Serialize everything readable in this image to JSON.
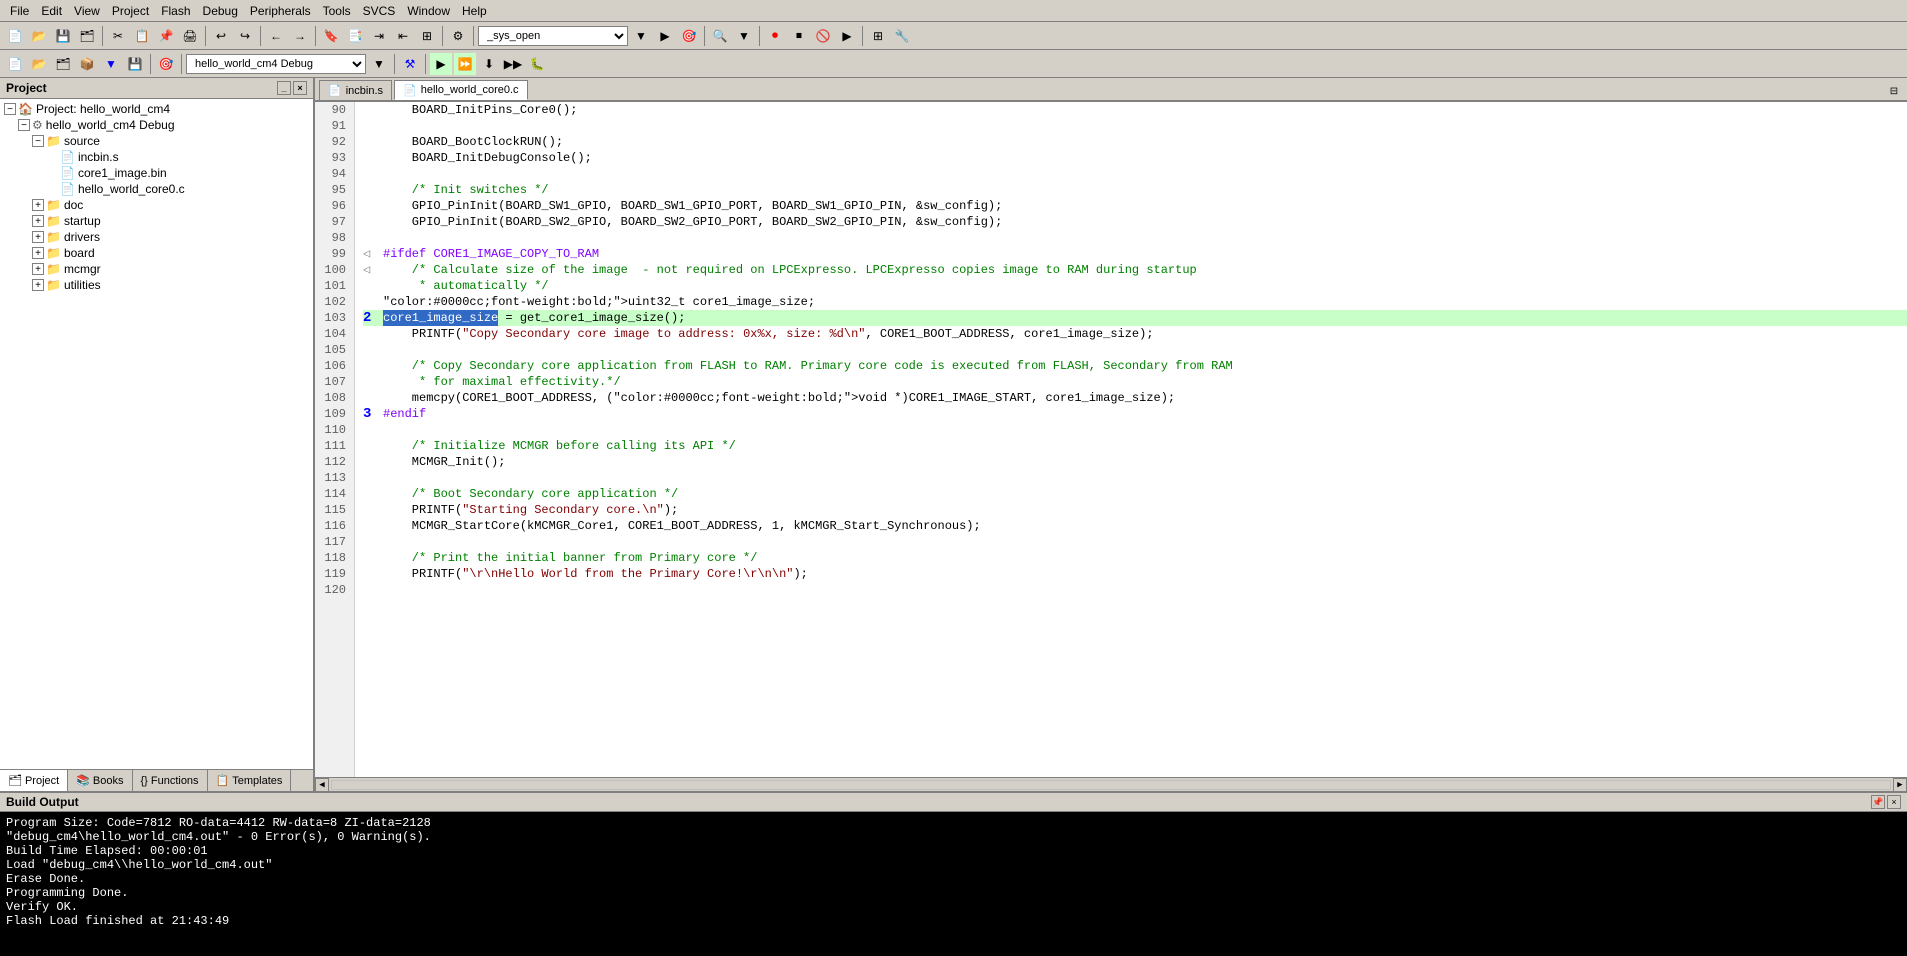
{
  "menubar": {
    "items": [
      "File",
      "Edit",
      "View",
      "Project",
      "Flash",
      "Debug",
      "Peripherals",
      "Tools",
      "SVCS",
      "Window",
      "Help"
    ]
  },
  "toolbar1": {
    "dropdown_value": "_sys_open"
  },
  "toolbar2": {
    "dropdown_value": "hello_world_cm4 Debug"
  },
  "project": {
    "title": "Project",
    "tree": [
      {
        "id": "root",
        "label": "Project: hello_world_cm4",
        "indent": 0,
        "icon": "📁",
        "expanded": true,
        "type": "project"
      },
      {
        "id": "debug",
        "label": "hello_world_cm4 Debug",
        "indent": 1,
        "icon": "🔧",
        "expanded": true,
        "type": "config"
      },
      {
        "id": "source",
        "label": "source",
        "indent": 2,
        "icon": "📁",
        "expanded": true,
        "type": "folder"
      },
      {
        "id": "incbin",
        "label": "incbin.s",
        "indent": 3,
        "icon": "📄",
        "expanded": false,
        "type": "file"
      },
      {
        "id": "core1img",
        "label": "core1_image.bin",
        "indent": 3,
        "icon": "📄",
        "expanded": false,
        "type": "file"
      },
      {
        "id": "core0",
        "label": "hello_world_core0.c",
        "indent": 3,
        "icon": "📄",
        "expanded": false,
        "type": "file"
      },
      {
        "id": "doc",
        "label": "doc",
        "indent": 2,
        "icon": "📁",
        "expanded": false,
        "type": "folder"
      },
      {
        "id": "startup",
        "label": "startup",
        "indent": 2,
        "icon": "📁",
        "expanded": false,
        "type": "folder"
      },
      {
        "id": "drivers",
        "label": "drivers",
        "indent": 2,
        "icon": "📁",
        "expanded": false,
        "type": "folder"
      },
      {
        "id": "board",
        "label": "board",
        "indent": 2,
        "icon": "📁",
        "expanded": false,
        "type": "folder"
      },
      {
        "id": "mcmgr",
        "label": "mcmgr",
        "indent": 2,
        "icon": "📁",
        "expanded": false,
        "type": "folder"
      },
      {
        "id": "utilities",
        "label": "utilities",
        "indent": 2,
        "icon": "📁",
        "expanded": false,
        "type": "folder"
      }
    ],
    "tabs": [
      {
        "id": "project-tab",
        "label": "Project",
        "icon": "🗂",
        "active": true
      },
      {
        "id": "books-tab",
        "label": "Books",
        "icon": "📚",
        "active": false
      },
      {
        "id": "functions-tab",
        "label": "Functions",
        "icon": "{}",
        "active": false
      },
      {
        "id": "templates-tab",
        "label": "Templates",
        "icon": "📋",
        "active": false
      }
    ]
  },
  "editor": {
    "tabs": [
      {
        "id": "incbin-tab",
        "label": "incbin.s",
        "active": false,
        "icon": "📄"
      },
      {
        "id": "core0-tab",
        "label": "hello_world_core0.c",
        "active": true,
        "icon": "📄"
      }
    ],
    "lines": [
      {
        "num": 90,
        "content": "    BOARD_InitPins_Core0();",
        "highlight": false
      },
      {
        "num": 91,
        "content": ""
      },
      {
        "num": 92,
        "content": "    BOARD_BootClockRUN();",
        "highlight": false
      },
      {
        "num": 93,
        "content": "    BOARD_InitDebugConsole();",
        "highlight": false
      },
      {
        "num": 94,
        "content": ""
      },
      {
        "num": 95,
        "content": "    /* Init switches */",
        "highlight": false,
        "comment": true
      },
      {
        "num": 96,
        "content": "    GPIO_PinInit(BOARD_SW1_GPIO, BOARD_SW1_GPIO_PORT, BOARD_SW1_GPIO_PIN, &sw_config);",
        "highlight": false
      },
      {
        "num": 97,
        "content": "    GPIO_PinInit(BOARD_SW2_GPIO, BOARD_SW2_GPIO_PORT, BOARD_SW2_GPIO_PIN, &sw_config);",
        "highlight": false
      },
      {
        "num": 98,
        "content": ""
      },
      {
        "num": 99,
        "content": "#ifdef CORE1_IMAGE_COPY_TO_RAM",
        "highlight": false,
        "preprocessor": true
      },
      {
        "num": 100,
        "content": "    /* Calculate size of the image  - not required on LPCExpresso. LPCExpresso copies image to RAM during startup",
        "highlight": false,
        "comment": true
      },
      {
        "num": 101,
        "content": "     * automatically */",
        "highlight": false,
        "comment": true
      },
      {
        "num": 102,
        "content": "    uint32_t core1_image_size;",
        "highlight": false
      },
      {
        "num": 103,
        "content": "    core1_image_size = get_core1_image_size();",
        "highlight": true,
        "breakpoint": true
      },
      {
        "num": 104,
        "content": "    PRINTF(\"Copy Secondary core image to address: 0x%x, size: %d\\n\", CORE1_BOOT_ADDRESS, core1_image_size);",
        "highlight": false
      },
      {
        "num": 105,
        "content": ""
      },
      {
        "num": 106,
        "content": "    /* Copy Secondary core application from FLASH to RAM. Primary core code is executed from FLASH, Secondary from RAM",
        "highlight": false,
        "comment": true
      },
      {
        "num": 107,
        "content": "     * for maximal effectivity.*/",
        "highlight": false,
        "comment": true
      },
      {
        "num": 108,
        "content": "    memcpy(CORE1_BOOT_ADDRESS, (void *)CORE1_IMAGE_START, core1_image_size);",
        "highlight": false
      },
      {
        "num": 109,
        "content": "#endif",
        "highlight": false,
        "preprocessor": true
      },
      {
        "num": 110,
        "content": ""
      },
      {
        "num": 111,
        "content": "    /* Initialize MCMGR before calling its API */",
        "highlight": false,
        "comment": true
      },
      {
        "num": 112,
        "content": "    MCMGR_Init();",
        "highlight": false
      },
      {
        "num": 113,
        "content": ""
      },
      {
        "num": 114,
        "content": "    /* Boot Secondary core application */",
        "highlight": false,
        "comment": true
      },
      {
        "num": 115,
        "content": "    PRINTF(\"Starting Secondary core.\\n\");",
        "highlight": false
      },
      {
        "num": 116,
        "content": "    MCMGR_StartCore(kMCMGR_Core1, CORE1_BOOT_ADDRESS, 1, kMCMGR_Start_Synchronous);",
        "highlight": false
      },
      {
        "num": 117,
        "content": ""
      },
      {
        "num": 118,
        "content": "    /* Print the initial banner from Primary core */",
        "highlight": false,
        "comment": true
      },
      {
        "num": 119,
        "content": "    PRINTF(\"\\r\\nHello World from the Primary Core!\\r\\n\\n\");",
        "highlight": false
      },
      {
        "num": 120,
        "content": ""
      }
    ]
  },
  "build_output": {
    "title": "Build Output",
    "lines": [
      "Program Size: Code=7812 RO-data=4412 RW-data=8 ZI-data=2128",
      "\"debug_cm4\\hello_world_cm4.out\" - 0 Error(s), 0 Warning(s).",
      "Build Time Elapsed:  00:00:01",
      "Load \"debug_cm4\\\\hello_world_cm4.out\"",
      "Erase Done.",
      "Programming Done.",
      "Verify OK.",
      "Flash Load finished at 21:43:49"
    ]
  }
}
